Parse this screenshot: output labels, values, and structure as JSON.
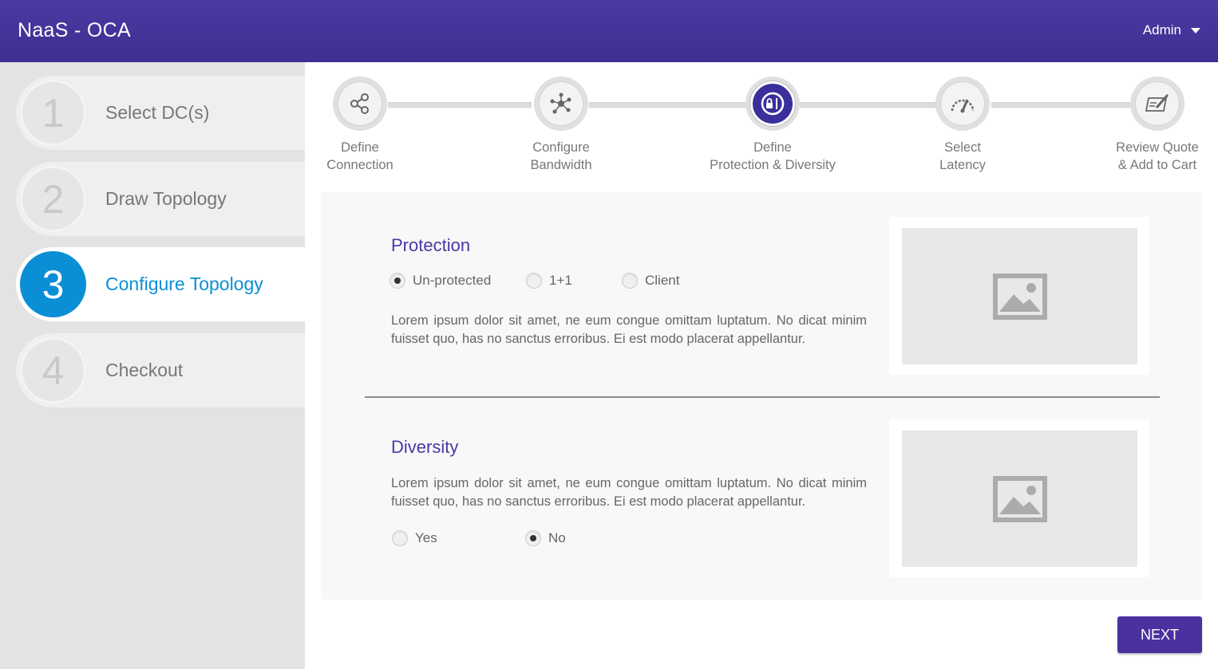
{
  "header": {
    "app_title": "NaaS - OCA",
    "user_label": "Admin"
  },
  "sidebar": {
    "items": [
      {
        "number": "1",
        "label": "Select DC(s)"
      },
      {
        "number": "2",
        "label": "Draw Topology"
      },
      {
        "number": "3",
        "label": "Configure Topology",
        "active": true
      },
      {
        "number": "4",
        "label": "Checkout"
      }
    ]
  },
  "stepper": {
    "steps": [
      {
        "line1": "Define",
        "line2": "Connection",
        "icon": "share-icon"
      },
      {
        "line1": "Configure",
        "line2": "Bandwidth",
        "icon": "network-hub-icon"
      },
      {
        "line1": "Define",
        "line2": "Protection & Diversity",
        "icon": "shield-lock-icon",
        "active": true
      },
      {
        "line1": "Select",
        "line2": "Latency",
        "icon": "speedometer-icon"
      },
      {
        "line1": "Review Quote",
        "line2": "& Add to Cart",
        "icon": "edit-document-icon"
      }
    ]
  },
  "protection": {
    "title": "Protection",
    "options": [
      "Un-protected",
      "1+1",
      "Client"
    ],
    "selected": "Un-protected",
    "description": "Lorem ipsum dolor sit amet, ne eum congue omittam luptatum. No dicat minim fuisset quo, has no sanctus erroribus. Ei est modo placerat appellantur."
  },
  "diversity": {
    "title": "Diversity",
    "description": "Lorem ipsum dolor sit amet, ne eum congue omittam luptatum. No dicat minim fuisset quo, has no sanctus erroribus. Ei est modo placerat appellantur.",
    "options": [
      "Yes",
      "No"
    ],
    "selected": "No"
  },
  "actions": {
    "next_label": "NEXT"
  },
  "colors": {
    "header": "#4a3aa2",
    "accent_blue": "#0a8fd6",
    "accent_purple": "#4b37a5",
    "button": "#4b31a0"
  }
}
